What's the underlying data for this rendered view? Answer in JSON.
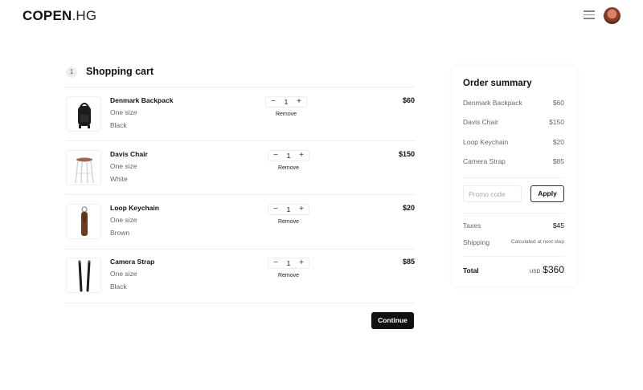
{
  "brand": {
    "name": "COPEN",
    "suffix": ".HG"
  },
  "header": {
    "menu_icon": "hamburger-menu-icon",
    "avatar_icon": "user-avatar"
  },
  "cart": {
    "step_number": "1",
    "title": "Shopping cart",
    "remove_label": "Remove",
    "decrement_glyph": "−",
    "increment_glyph": "+",
    "items": [
      {
        "name": "Denmark Backpack",
        "size": "One size",
        "color": "Black",
        "quantity": "1",
        "price": "$60",
        "image": "backpack-image"
      },
      {
        "name": "Davis Chair",
        "size": "One size",
        "color": "White",
        "quantity": "1",
        "price": "$150",
        "image": "chair-image"
      },
      {
        "name": "Loop Keychain",
        "size": "One size",
        "color": "Brown",
        "quantity": "1",
        "price": "$20",
        "image": "keychain-image"
      },
      {
        "name": "Camera Strap",
        "size": "One size",
        "color": "Black",
        "quantity": "1",
        "price": "$85",
        "image": "camera-strap-image"
      }
    ],
    "continue_label": "Continue"
  },
  "summary": {
    "title": "Order summary",
    "lines": [
      {
        "label": "Denmark Backpack",
        "value": "$60"
      },
      {
        "label": "Davis Chair",
        "value": "$150"
      },
      {
        "label": "Loop Keychain",
        "value": "$20"
      },
      {
        "label": "Camera Strap",
        "value": "$85"
      }
    ],
    "promo_placeholder": "Promo code",
    "apply_label": "Apply",
    "taxes_label": "Taxes",
    "taxes_value": "$45",
    "shipping_label": "Shipping",
    "shipping_value": "Calculated at next step",
    "total_label": "Total",
    "total_currency": "USD",
    "total_value": "$360"
  },
  "colors": {
    "text": "#111111",
    "muted": "#666666",
    "button_dark": "#111111",
    "divider": "#efefef"
  }
}
